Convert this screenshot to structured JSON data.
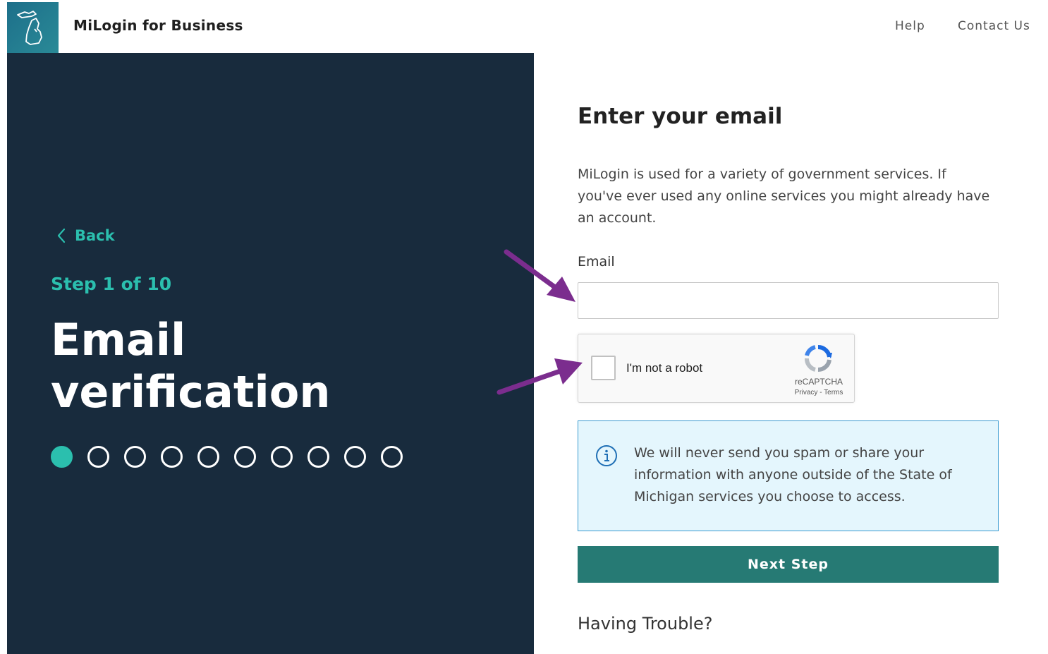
{
  "header": {
    "app_title": "MiLogin for Business",
    "nav": {
      "help": "Help",
      "contact": "Contact Us"
    }
  },
  "sidebar": {
    "back_label": "Back",
    "step_label": "Step 1 of 10",
    "heading_line1": "Email",
    "heading_line2": "verification",
    "progress": {
      "current_step": 1,
      "total_steps": 10
    }
  },
  "form": {
    "title": "Enter your email",
    "intro": "MiLogin is used for a variety of government services. If you've ever used any online services you might already have an account.",
    "email_label": "Email",
    "email_value": "",
    "recaptcha": {
      "label": "I'm not a robot",
      "brand": "reCAPTCHA",
      "links": "Privacy - Terms"
    },
    "info_text": "We will never send you spam or share your information with anyone outside of the State of Michigan services you choose to access.",
    "next_button": "Next Step",
    "trouble_heading": "Having Trouble?"
  },
  "colors": {
    "sidebar_bg": "#182b3d",
    "accent_teal": "#2bbfae",
    "button_bg": "#267a74",
    "info_bg": "#e4f6fd",
    "info_border": "#3a9ad0",
    "annotation_arrow": "#7b2d8e"
  },
  "icons": {
    "logo": "michigan-state-icon",
    "back": "chevron-left-icon",
    "info": "info-circle-icon",
    "recaptcha": "recaptcha-logo-icon"
  }
}
